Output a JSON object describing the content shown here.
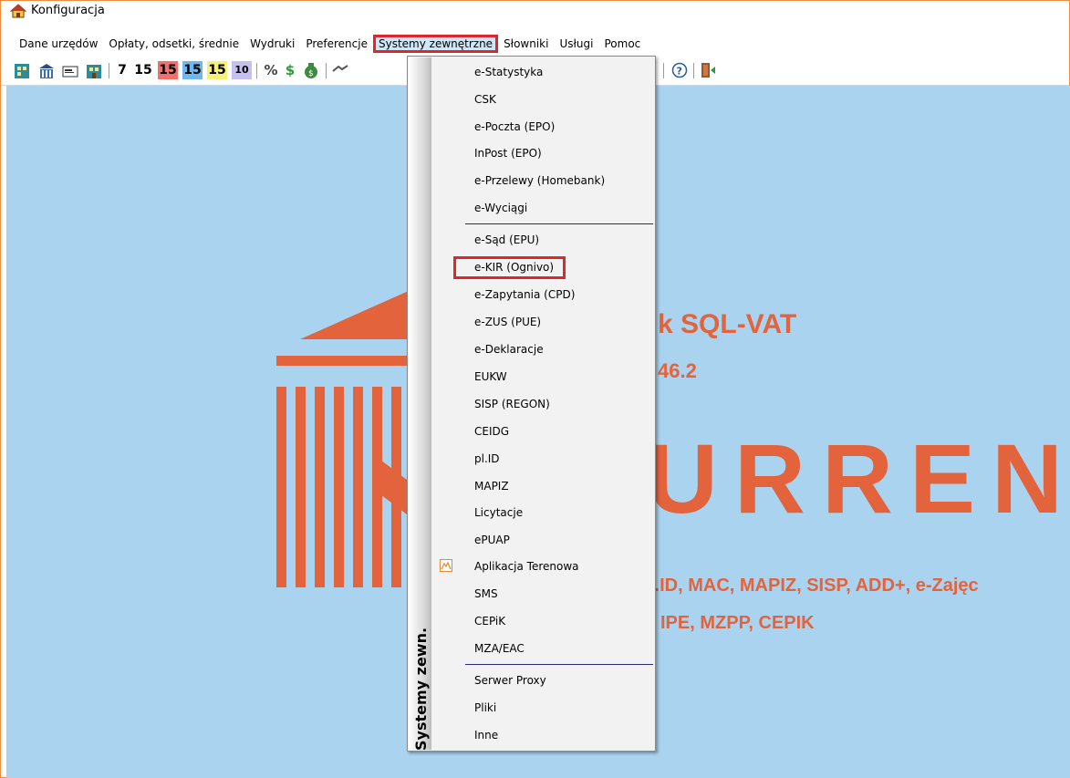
{
  "window": {
    "title": "Konfiguracja"
  },
  "menubar": {
    "items": [
      {
        "label": "Dane urzędów"
      },
      {
        "label": "Opłaty, odsetki, średnie"
      },
      {
        "label": "Wydruki"
      },
      {
        "label": "Preferencje"
      },
      {
        "label": "Systemy zewnętrzne"
      },
      {
        "label": "Słowniki"
      },
      {
        "label": "Usługi"
      },
      {
        "label": "Pomoc"
      }
    ]
  },
  "toolbar": {
    "num_7": "7",
    "num_15a": "15",
    "num_15b": "15",
    "num_15c": "15",
    "num_15d": "15",
    "num_10": "10",
    "percent": "%",
    "dollar": "$",
    "help": "?"
  },
  "splash": {
    "product": "k SQL-VAT",
    "version": "46.2",
    "brand": "URREN",
    "modules_line1": "l.ID, MAC, MAPIZ, SISP, ADD+, e-Zajęc",
    "modules_line2": "IPE, MZPP, CEPIK"
  },
  "dropdown": {
    "strip_label": "Systemy zewn.",
    "items": [
      {
        "label": "e-Statystyka"
      },
      {
        "label": "CSK"
      },
      {
        "label": "e-Poczta (EPO)"
      },
      {
        "label": "InPost (EPO)"
      },
      {
        "label": "e-Przelewy (Homebank)"
      },
      {
        "label": "e-Wyciągi"
      },
      {
        "label": "e-Sąd (EPU)"
      },
      {
        "label": "e-KIR (Ognivo)"
      },
      {
        "label": "e-Zapytania (CPD)"
      },
      {
        "label": "e-ZUS (PUE)"
      },
      {
        "label": "e-Deklaracje"
      },
      {
        "label": "EUKW"
      },
      {
        "label": "SISP (REGON)"
      },
      {
        "label": "CEIDG"
      },
      {
        "label": "pl.ID"
      },
      {
        "label": "MAPIZ"
      },
      {
        "label": "Licytacje"
      },
      {
        "label": "ePUAP"
      },
      {
        "label": "Aplikacja Terenowa",
        "icon": "mountain-icon"
      },
      {
        "label": "SMS"
      },
      {
        "label": "CEPiK"
      },
      {
        "label": "MZA/EAC"
      },
      {
        "label": "Serwer Proxy"
      },
      {
        "label": "Pliki"
      },
      {
        "label": "Inne"
      }
    ]
  },
  "colors": {
    "accent_red": "#e0262d",
    "splash_orange": "#e3633d",
    "desktop_blue": "#a9d3ee"
  }
}
